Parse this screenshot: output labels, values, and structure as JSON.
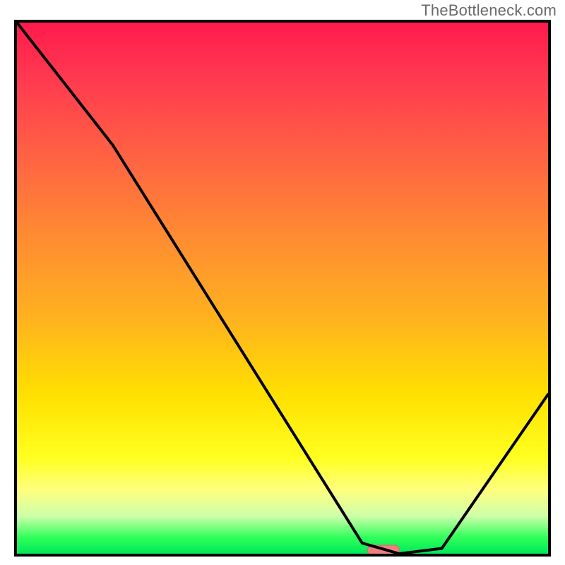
{
  "watermark": "TheBottleneck.com",
  "colors": {
    "border": "#000000",
    "curve": "#000000",
    "marker_fill": "#f08080",
    "marker_stroke": "#d46a6a",
    "gradient": [
      "#ff1a4d",
      "#ff6a40",
      "#ffb020",
      "#ffff20",
      "#ccffaa",
      "#00e85a"
    ]
  },
  "chart_data": {
    "type": "line",
    "title": "",
    "xlabel": "",
    "ylabel": "",
    "xlim": [
      0,
      100
    ],
    "ylim": [
      0,
      100
    ],
    "series": [
      {
        "name": "bottleneck-curve",
        "x": [
          0,
          18,
          65,
          72,
          80,
          100
        ],
        "values": [
          100,
          77,
          2,
          0,
          1,
          30
        ]
      }
    ],
    "annotations": [
      {
        "name": "optimal-range-marker",
        "x_center": 69,
        "y": 0,
        "width": 6,
        "color": "#f08080"
      }
    ]
  }
}
